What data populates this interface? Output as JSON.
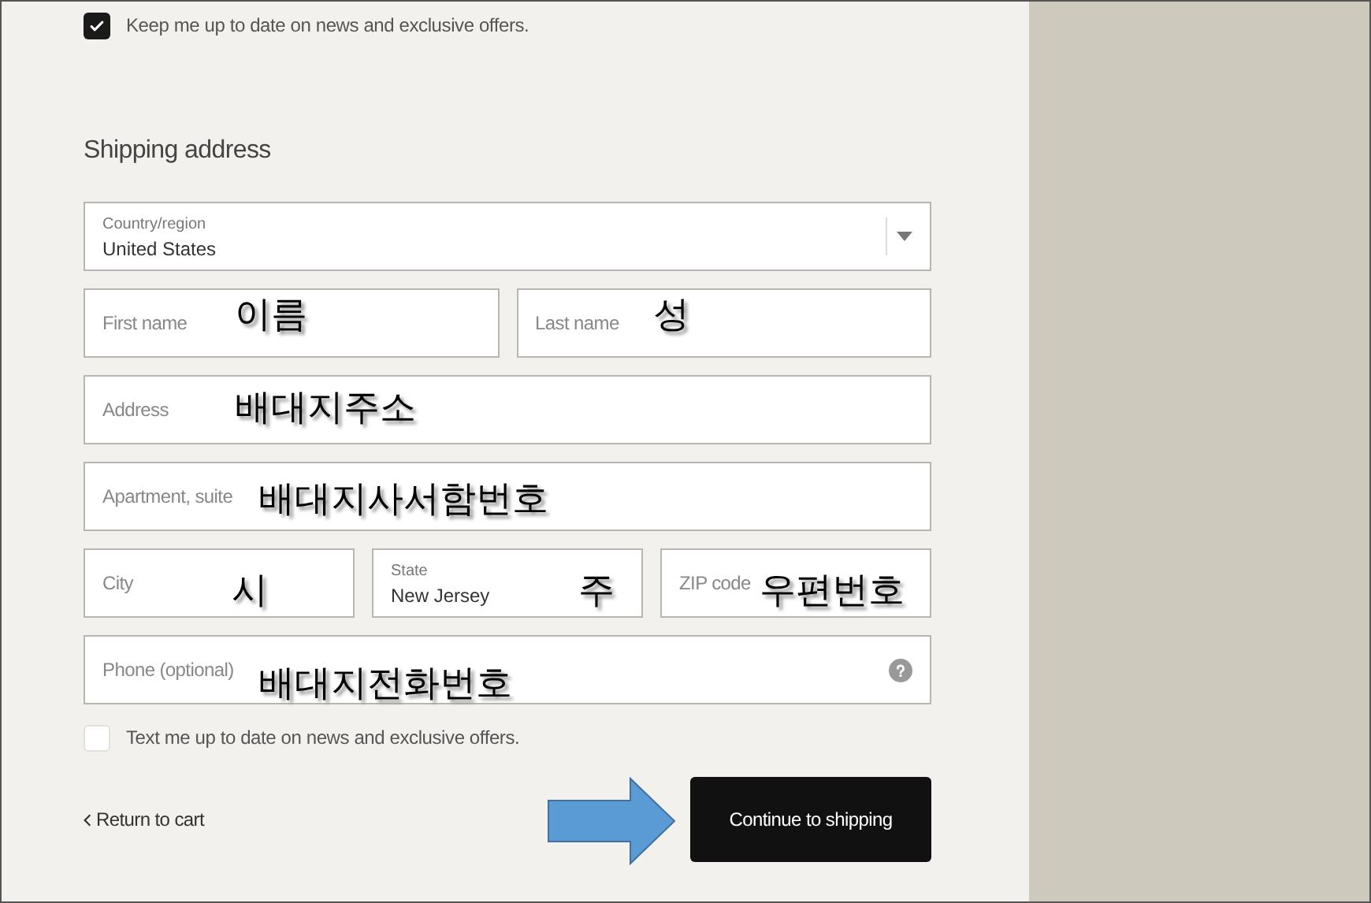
{
  "newsletter": {
    "label": "Keep me up to date on news and exclusive offers.",
    "checked": true
  },
  "section_title": "Shipping address",
  "field_rows": [
    [
      {
        "kind": "select",
        "label": "Country/region",
        "value": "United States",
        "dropdown_caret": true
      }
    ],
    [
      {
        "kind": "text",
        "placeholder": "First name",
        "annotation": "이름"
      },
      {
        "kind": "text",
        "placeholder": "Last name",
        "annotation": "성"
      }
    ],
    [
      {
        "kind": "text",
        "placeholder": "Address",
        "annotation": "배대지주소"
      }
    ],
    [
      {
        "kind": "text",
        "placeholder": "Apartment, suite",
        "annotation": "배대지사서함번호"
      }
    ],
    [
      {
        "kind": "text",
        "placeholder": "City",
        "annotation": "시"
      },
      {
        "kind": "select",
        "label": "State",
        "value": "New Jersey",
        "annotation": "주"
      },
      {
        "kind": "text",
        "placeholder": "ZIP code",
        "annotation": "우편번호"
      }
    ],
    [
      {
        "kind": "text",
        "placeholder": "Phone (optional)",
        "annotation": "배대지전화번호",
        "help_icon": true
      }
    ]
  ],
  "sms_opt_in": {
    "label": "Text me up to date on news and exclusive offers.",
    "checked": false
  },
  "return_link": "Return to cart",
  "continue_button": "Continue to shipping"
}
